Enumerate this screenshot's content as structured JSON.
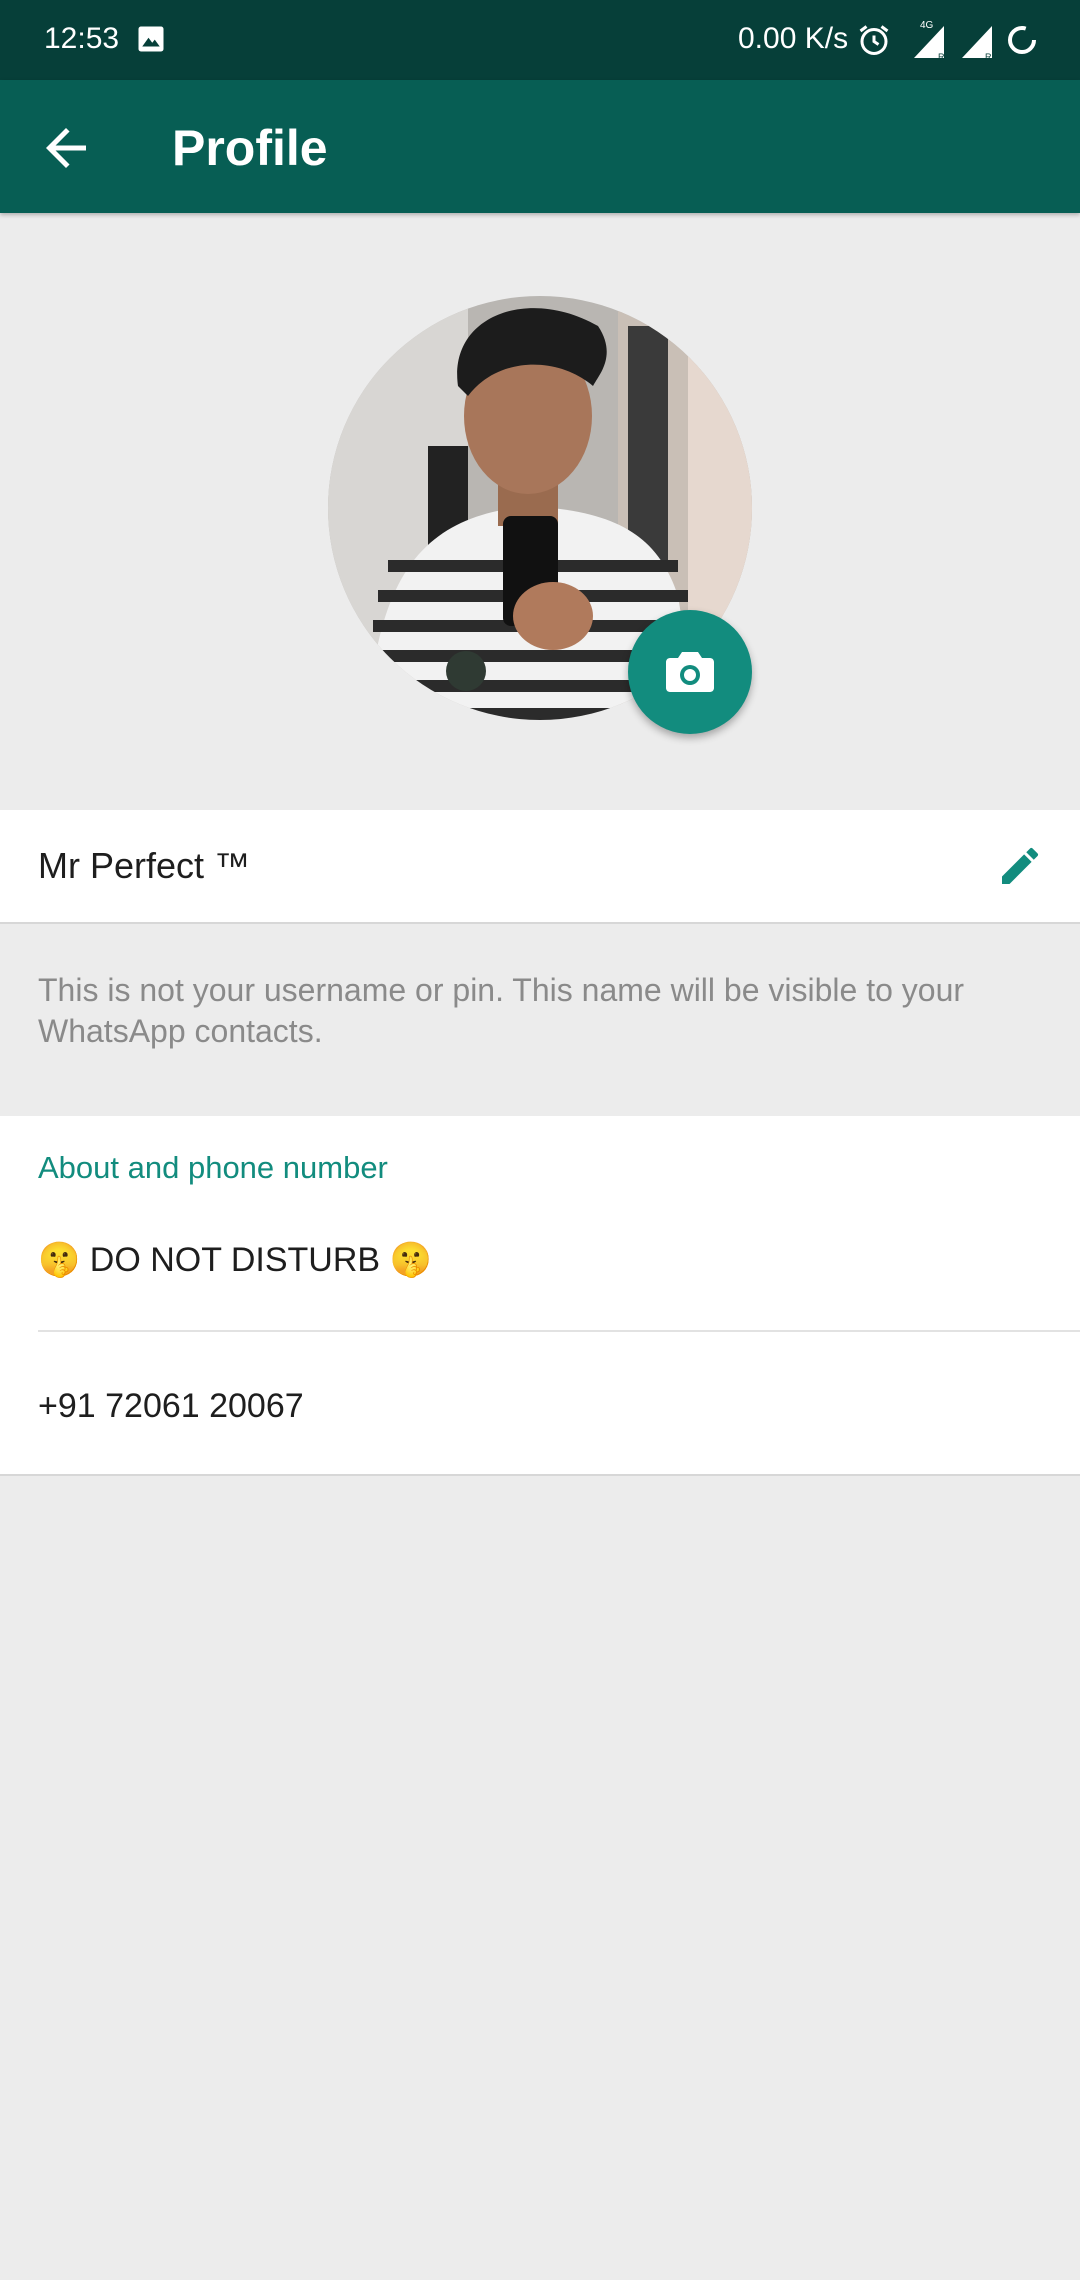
{
  "status_bar": {
    "time": "12:53",
    "network_speed": "0.00 K/s",
    "icons": [
      "image-icon",
      "alarm-icon",
      "signal-4g-icon",
      "signal-icon",
      "loading-ring-icon"
    ],
    "background": "#063f39"
  },
  "app_bar": {
    "title": "Profile",
    "background": "#075e54",
    "back_icon": "arrow-back-icon"
  },
  "profile": {
    "photo_alt": "profile-photo",
    "camera_icon": "camera-icon",
    "accent": "#128c7e"
  },
  "name": {
    "value": "Mr Perfect ™",
    "edit_icon": "pencil-icon",
    "hint": "This is not your username or pin. This name will be visible to your WhatsApp contacts."
  },
  "about_section": {
    "header": "About and phone number",
    "about": "🤫 DO NOT DISTURB 🤫",
    "phone": "+91 72061 20067"
  }
}
